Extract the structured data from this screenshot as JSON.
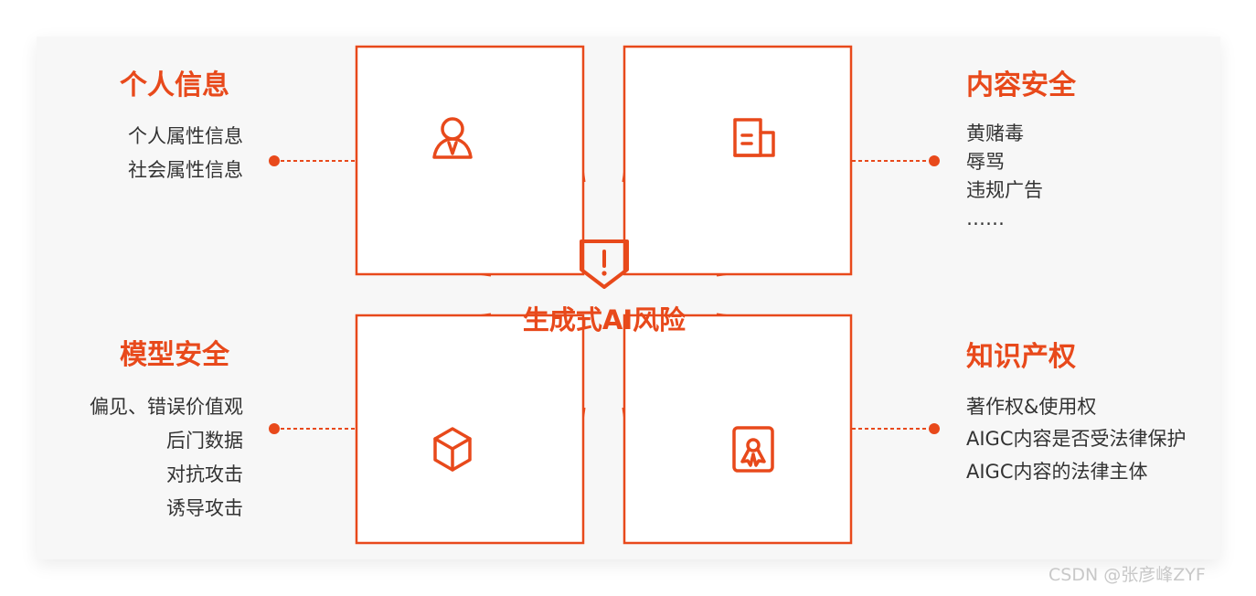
{
  "center": {
    "title": "生成式AI风险",
    "icon": "shield-warning-icon"
  },
  "quadrants": {
    "personal_info": {
      "title": "个人信息",
      "icon": "person-icon",
      "items": [
        "个人属性信息",
        "社会属性信息"
      ]
    },
    "content_safety": {
      "title": "内容安全",
      "icon": "document-icon",
      "items": [
        "黄赌毒",
        "辱骂",
        "违规广告",
        "……"
      ]
    },
    "model_safety": {
      "title": "模型安全",
      "icon": "cube-icon",
      "items": [
        "偏见、错误价值观",
        "后门数据",
        "对抗攻击",
        "诱导攻击"
      ]
    },
    "ip_rights": {
      "title": "知识产权",
      "icon": "certificate-icon",
      "items": [
        "著作权&使用权",
        "AIGC内容是否受法律保护",
        "AIGC内容的法律主体"
      ]
    }
  },
  "watermark": "CSDN @张彦峰ZYF",
  "colors": {
    "accent": "#e8491b",
    "text": "#333333",
    "panel": "#f7f7f7",
    "watermark": "#c8c8c8"
  }
}
